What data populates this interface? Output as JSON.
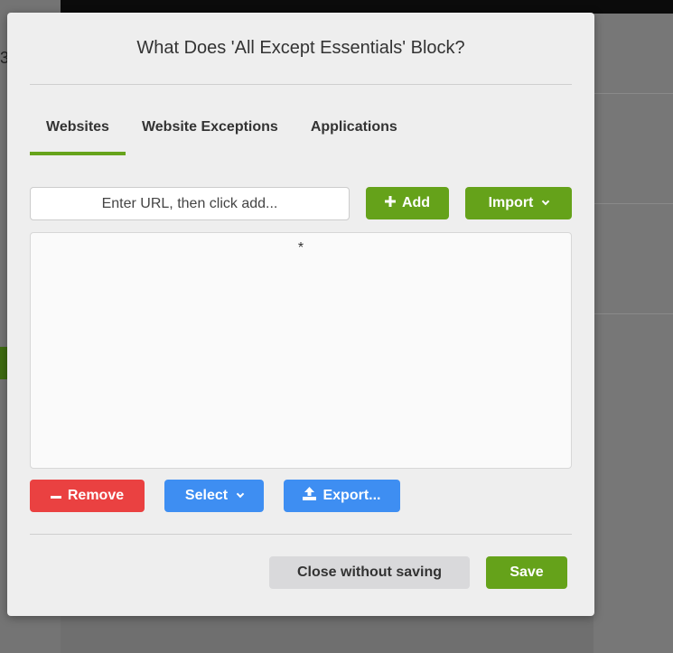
{
  "background": {
    "letter": "3"
  },
  "dialog": {
    "title": "What Does 'All Except Essentials' Block?",
    "tabs": [
      {
        "label": "Websites",
        "active": true
      },
      {
        "label": "Website Exceptions",
        "active": false
      },
      {
        "label": "Applications",
        "active": false
      }
    ],
    "url_input": {
      "placeholder": "Enter URL, then click add...",
      "value": ""
    },
    "add_label": "Add",
    "import_label": "Import",
    "list_items": [
      "*"
    ],
    "remove_label": "Remove",
    "select_label": "Select",
    "export_label": "Export...",
    "close_label": "Close without saving",
    "save_label": "Save"
  },
  "colors": {
    "accent_green": "#65a21a",
    "remove_red": "#ea4141",
    "action_blue": "#3e8ef2",
    "secondary_gray": "#d9d9db"
  },
  "icons": {
    "add": "plus-icon",
    "import": "chevron-down-icon",
    "remove": "minus-icon",
    "select": "chevron-down-icon",
    "export": "upload-icon"
  }
}
